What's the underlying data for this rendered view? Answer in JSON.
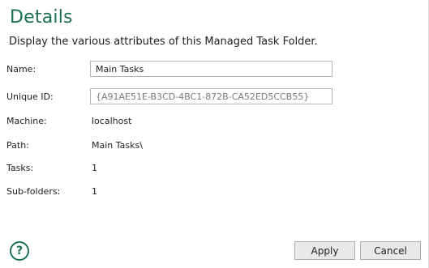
{
  "header": {
    "title": "Details",
    "subtitle": "Display the various attributes of this Managed Task Folder."
  },
  "fields": {
    "name_label": "Name:",
    "name_value": "Main Tasks",
    "unique_id_label": "Unique ID:",
    "unique_id_value": "{A91AE51E-B3CD-4BC1-872B-CA52ED5CCB55}",
    "machine_label": "Machine:",
    "machine_value": "localhost",
    "path_label": "Path:",
    "path_value": "Main Tasks\\",
    "tasks_label": "Tasks:",
    "tasks_value": "1",
    "subfolders_label": "Sub-folders:",
    "subfolders_value": "1"
  },
  "footer": {
    "help_icon_glyph": "?",
    "apply_label": "Apply",
    "cancel_label": "Cancel"
  },
  "colors": {
    "accent": "#1d6f58",
    "text": "#1e1e1e",
    "muted_text": "#7a7a7a",
    "button_bg": "#e9e9e9",
    "border": "#b5b5b5"
  }
}
